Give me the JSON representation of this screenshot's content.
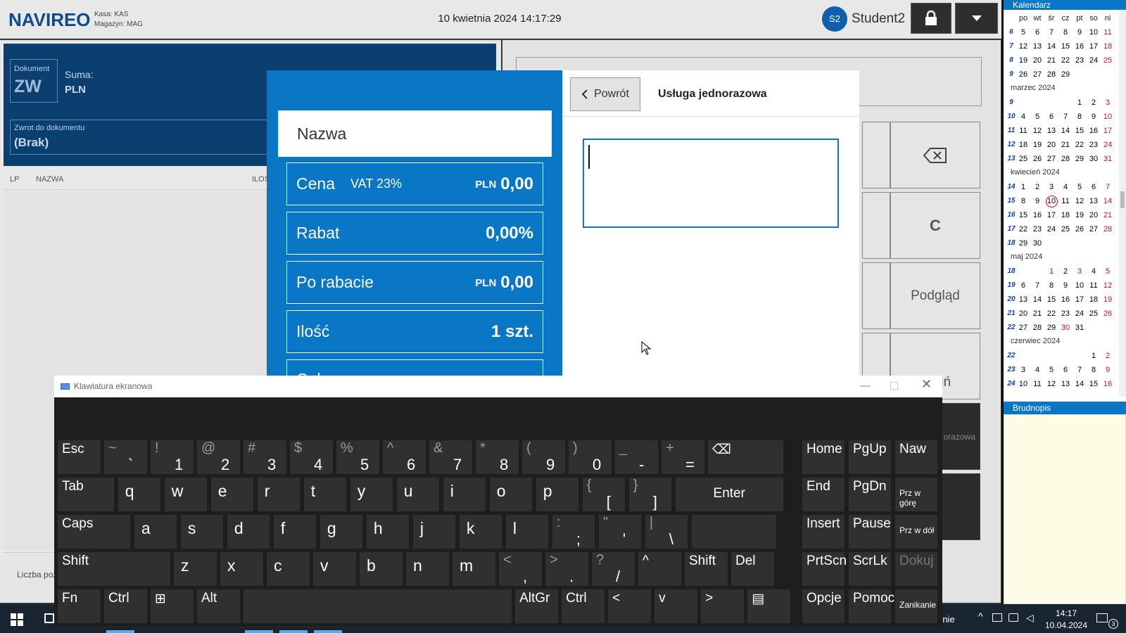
{
  "topbar": {
    "logo": "NAVIREO",
    "kasa": "Kasa: KAS",
    "magazyn": "Magazyn: MAG",
    "datetime": "10 kwietnia 2024 14:17:29",
    "avatar": "S2",
    "user": "Student2"
  },
  "document": {
    "label": "Dokument",
    "type": "ZW",
    "sum_label": "Suma:",
    "currency": "PLN",
    "zwrot_label": "Zwrot do dokumentu",
    "zwrot_value": "(Brak)"
  },
  "table": {
    "col_lp": "LP",
    "col_nazwa": "NAZWA",
    "col_ilosc": "ILOŚ"
  },
  "footer": {
    "count_label": "Liczba poz"
  },
  "keypad": {
    "podglad": "Podgląd",
    "usun": "Usuń",
    "c": "C",
    "dark": "orazowa"
  },
  "dialog": {
    "name_label": "Nazwa",
    "cena": {
      "label": "Cena",
      "vat": "VAT 23%",
      "currency": "PLN",
      "value": "0,00"
    },
    "rabat": {
      "label": "Rabat",
      "value": "0,00%"
    },
    "po_rabacie": {
      "label": "Po rabacie",
      "currency": "PLN",
      "value": "0,00"
    },
    "ilosc": {
      "label": "Ilość",
      "value": "1 szt."
    },
    "partial": "Cel",
    "back": "Powrót",
    "title": "Usługa jednorazowa"
  },
  "calendar": {
    "title": "Kalendarz",
    "days": [
      "po",
      "wt",
      "śr",
      "cz",
      "pt",
      "so",
      "ni"
    ],
    "rows": [
      {
        "wk": "6",
        "d": [
          "5",
          "6",
          "7",
          "8",
          "9",
          "10",
          "11"
        ]
      },
      {
        "wk": "7",
        "d": [
          "12",
          "13",
          "14",
          "15",
          "16",
          "17",
          "18"
        ]
      },
      {
        "wk": "8",
        "d": [
          "19",
          "20",
          "21",
          "22",
          "23",
          "24",
          "25"
        ]
      },
      {
        "wk": "9",
        "d": [
          "26",
          "27",
          "28",
          "29",
          "",
          "",
          ""
        ]
      },
      {
        "month": "marzec 2024"
      },
      {
        "wk": "9",
        "d": [
          "",
          "",
          "",
          "",
          "1",
          "2",
          "3"
        ]
      },
      {
        "wk": "10",
        "d": [
          "4",
          "5",
          "6",
          "7",
          "8",
          "9",
          "10"
        ]
      },
      {
        "wk": "11",
        "d": [
          "11",
          "12",
          "13",
          "14",
          "15",
          "16",
          "17"
        ]
      },
      {
        "wk": "12",
        "d": [
          "18",
          "19",
          "20",
          "21",
          "22",
          "23",
          "24"
        ]
      },
      {
        "wk": "13",
        "d": [
          "25",
          "26",
          "27",
          "28",
          "29",
          "30",
          "31"
        ]
      },
      {
        "month": "kwiecień 2024"
      },
      {
        "wk": "14",
        "d": [
          "1",
          "2",
          "3",
          "4",
          "5",
          "6",
          "7"
        ]
      },
      {
        "wk": "15",
        "d": [
          "8",
          "9",
          "10",
          "11",
          "12",
          "13",
          "14"
        ]
      },
      {
        "wk": "16",
        "d": [
          "15",
          "16",
          "17",
          "18",
          "19",
          "20",
          "21"
        ]
      },
      {
        "wk": "17",
        "d": [
          "22",
          "23",
          "24",
          "25",
          "26",
          "27",
          "28"
        ]
      },
      {
        "wk": "18",
        "d": [
          "29",
          "30",
          "",
          "",
          "",
          "",
          ""
        ]
      },
      {
        "month": "maj 2024"
      },
      {
        "wk": "18",
        "d": [
          "",
          "",
          "1",
          "2",
          "3",
          "4",
          "5"
        ]
      },
      {
        "wk": "19",
        "d": [
          "6",
          "7",
          "8",
          "9",
          "10",
          "11",
          "12"
        ]
      },
      {
        "wk": "20",
        "d": [
          "13",
          "14",
          "15",
          "16",
          "17",
          "18",
          "19"
        ]
      },
      {
        "wk": "21",
        "d": [
          "20",
          "21",
          "22",
          "23",
          "24",
          "25",
          "26"
        ]
      },
      {
        "wk": "22",
        "d": [
          "27",
          "28",
          "29",
          "30",
          "31",
          "",
          ""
        ]
      },
      {
        "month": "czerwiec 2024"
      },
      {
        "wk": "22",
        "d": [
          "",
          "",
          "",
          "",
          "",
          "1",
          "2"
        ]
      },
      {
        "wk": "23",
        "d": [
          "3",
          "4",
          "5",
          "6",
          "7",
          "8",
          "9"
        ]
      },
      {
        "wk": "24",
        "d": [
          "10",
          "11",
          "12",
          "13",
          "14",
          "15",
          "16"
        ]
      }
    ],
    "today": "10",
    "brudnopis": "Brudnopis"
  },
  "osk": {
    "title": "Klawiatura ekranowa",
    "rows": [
      [
        {
          "m": "Esc",
          "w": 1
        },
        {
          "sh": "~",
          "lo": "`"
        },
        {
          "sh": "!",
          "lo": "1"
        },
        {
          "sh": "@",
          "lo": "2"
        },
        {
          "sh": "#",
          "lo": "3"
        },
        {
          "sh": "$",
          "lo": "4"
        },
        {
          "sh": "%",
          "lo": "5"
        },
        {
          "sh": "^",
          "lo": "6"
        },
        {
          "sh": "&",
          "lo": "7"
        },
        {
          "sh": "*",
          "lo": "8"
        },
        {
          "sh": "(",
          "lo": "9"
        },
        {
          "sh": ")",
          "lo": "0"
        },
        {
          "sh": "_",
          "lo": "-"
        },
        {
          "sh": "+",
          "lo": "="
        },
        {
          "m": "⌫",
          "w": 1.7
        }
      ],
      [
        {
          "m": "Tab",
          "w": 1.3
        },
        {
          "c": "q"
        },
        {
          "c": "w"
        },
        {
          "c": "e"
        },
        {
          "c": "r"
        },
        {
          "c": "t"
        },
        {
          "c": "y"
        },
        {
          "c": "u"
        },
        {
          "c": "i"
        },
        {
          "c": "o"
        },
        {
          "c": "p"
        },
        {
          "sh": "{",
          "lo": "["
        },
        {
          "sh": "}",
          "lo": "]"
        },
        {
          "m": "Enter",
          "w": 2.4,
          "center": true
        }
      ],
      [
        {
          "m": "Caps",
          "w": 1.65
        },
        {
          "c": "a"
        },
        {
          "c": "s"
        },
        {
          "c": "d"
        },
        {
          "c": "f"
        },
        {
          "c": "g"
        },
        {
          "c": "h"
        },
        {
          "c": "j"
        },
        {
          "c": "k"
        },
        {
          "c": "l"
        },
        {
          "sh": ":",
          "lo": ";"
        },
        {
          "sh": "\"",
          "lo": "'"
        },
        {
          "sh": "|",
          "lo": "\\"
        },
        {
          "m": "",
          "w": 1.9
        }
      ],
      [
        {
          "m": "Shift",
          "w": 2.5
        },
        {
          "c": "z"
        },
        {
          "c": "x"
        },
        {
          "c": "c"
        },
        {
          "c": "v"
        },
        {
          "c": "b"
        },
        {
          "c": "n"
        },
        {
          "c": "m"
        },
        {
          "sh": "<",
          "lo": ","
        },
        {
          "sh": ">",
          "lo": "."
        },
        {
          "sh": "?",
          "lo": "/"
        },
        {
          "m": "^"
        },
        {
          "m": "Shift"
        },
        {
          "m": "Del"
        }
      ],
      [
        {
          "m": "Fn"
        },
        {
          "m": "Ctrl"
        },
        {
          "m": "⊞"
        },
        {
          "m": "Alt"
        },
        {
          "m": "",
          "w": 5.85
        },
        {
          "m": "AltGr"
        },
        {
          "m": "Ctrl"
        },
        {
          "m": "<"
        },
        {
          "m": "v"
        },
        {
          "m": ">"
        },
        {
          "m": "▤"
        }
      ]
    ],
    "nav": [
      [
        "Home",
        "PgUp",
        "Naw"
      ],
      [
        "End",
        "PgDn",
        "Prz w górę"
      ],
      [
        "Insert",
        "Pause",
        "Prz w dół"
      ],
      [
        "PrtScn",
        "ScrLk",
        "Dokuj"
      ],
      [
        "Opcje",
        "Pomoc",
        "Zanikanie"
      ]
    ]
  },
  "taskbar": {
    "time": "14:17",
    "date": "10.04.2024",
    "notif": "3",
    "partial": "rnie"
  }
}
